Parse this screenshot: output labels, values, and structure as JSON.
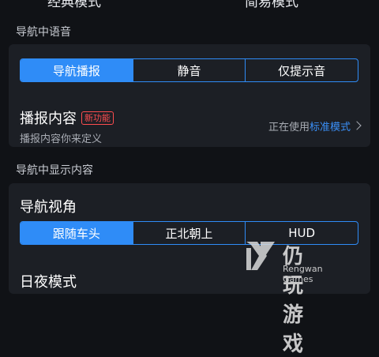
{
  "top_options": [
    "经典模式",
    "简易模式"
  ],
  "voice_section": {
    "label": "导航中语音",
    "options": [
      "导航播报",
      "静音",
      "仅提示音"
    ],
    "selected": "导航播报"
  },
  "broadcast": {
    "title": "播报内容",
    "badge": "新功能",
    "subtitle": "播报内容你来定义",
    "status_prefix": "正在使用",
    "status_value": "标准模式"
  },
  "display_section": {
    "label": "导航中显示内容",
    "view_title": "导航视角",
    "options": [
      "跟随车头",
      "正北朝上",
      "HUD"
    ],
    "selected": "跟随车头",
    "day_night_title": "日夜模式"
  },
  "watermark": {
    "brand": "仍玩游戏",
    "subtitle": "Rengwan Games"
  },
  "colors": {
    "accent": "#2f8cf7",
    "badge": "#ff4d4f",
    "background": "#101216",
    "card": "#1c1f25"
  }
}
